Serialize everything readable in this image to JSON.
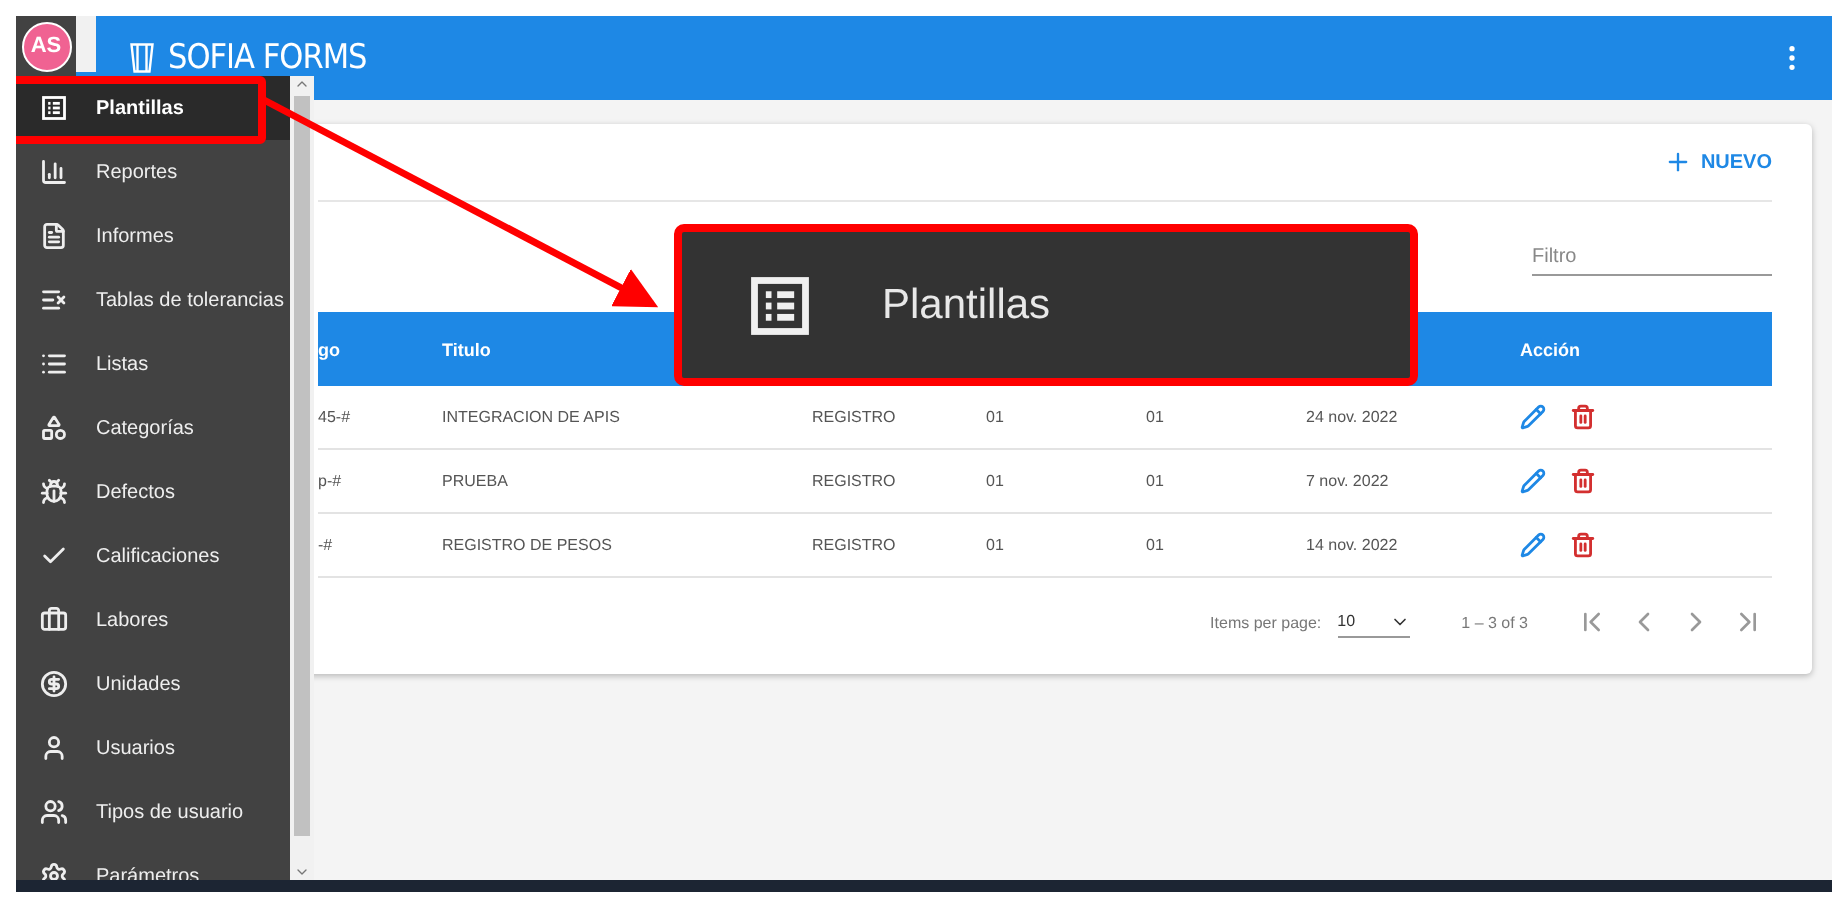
{
  "user": {
    "initials": "AS"
  },
  "app": {
    "title": "SOFIA FORMS"
  },
  "sidebar": {
    "items": [
      {
        "label": "Plantillas",
        "selected": true
      },
      {
        "label": "Reportes",
        "selected": false
      },
      {
        "label": "Informes",
        "selected": false
      },
      {
        "label": "Tablas de tolerancias",
        "selected": false
      },
      {
        "label": "Listas",
        "selected": false
      },
      {
        "label": "Categorías",
        "selected": false
      },
      {
        "label": "Defectos",
        "selected": false
      },
      {
        "label": "Calificaciones",
        "selected": false
      },
      {
        "label": "Labores",
        "selected": false
      },
      {
        "label": "Unidades",
        "selected": false
      },
      {
        "label": "Usuarios",
        "selected": false
      },
      {
        "label": "Tipos de usuario",
        "selected": false
      },
      {
        "label": "Parámetros",
        "selected": false
      }
    ]
  },
  "card": {
    "new_button": "NUEVO",
    "filter": {
      "placeholder": "Filtro"
    }
  },
  "table": {
    "header": {
      "column_1": "go",
      "column_2": "Titulo",
      "column_7": "Acción"
    },
    "rows": [
      {
        "column_1": "45-#",
        "column_2": "INTEGRACION DE APIS",
        "column_3": "REGISTRO",
        "column_4": "01",
        "column_5": "01",
        "column_6": "24 nov. 2022"
      },
      {
        "column_1": "p-#",
        "column_2": "PRUEBA",
        "column_3": "REGISTRO",
        "column_4": "01",
        "column_5": "01",
        "column_6": "7 nov. 2022"
      },
      {
        "column_1": "-#",
        "column_2": "REGISTRO DE PESOS",
        "column_3": "REGISTRO",
        "column_4": "01",
        "column_5": "01",
        "column_6": "14 nov. 2022"
      }
    ]
  },
  "paginator": {
    "items_label": "Items per page:",
    "page_size": "10",
    "range": "1 – 3 of 3"
  },
  "callout": {
    "label": "Plantillas"
  }
}
